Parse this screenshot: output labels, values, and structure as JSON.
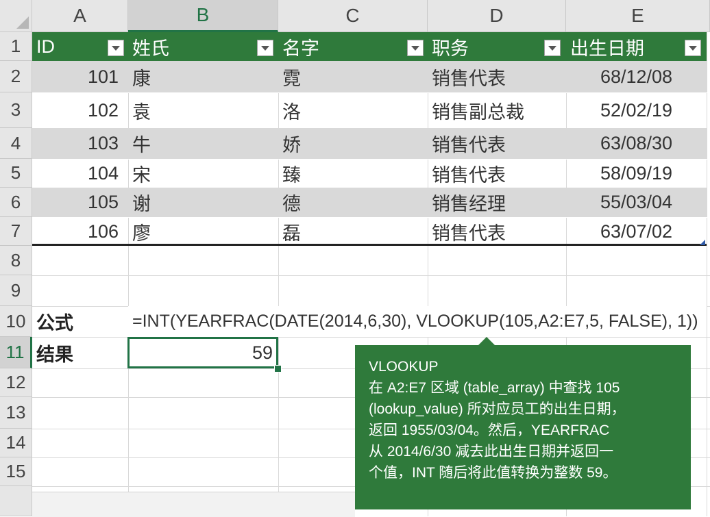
{
  "columns": [
    "A",
    "B",
    "C",
    "D",
    "E"
  ],
  "selected_column": "B",
  "rows": [
    "1",
    "2",
    "3",
    "4",
    "5",
    "6",
    "7",
    "8",
    "9",
    "10",
    "11",
    "12",
    "13",
    "14",
    "15"
  ],
  "selected_row": "11",
  "table": {
    "headers": [
      "ID",
      "姓氏",
      "名字",
      "职务",
      "出生日期"
    ],
    "body": [
      [
        "101",
        "康",
        "霓",
        "销售代表",
        "68/12/08"
      ],
      [
        "102",
        "袁",
        "洛",
        "销售副总裁",
        "52/02/19"
      ],
      [
        "103",
        "牛",
        "娇",
        "销售代表",
        "63/08/30"
      ],
      [
        "104",
        "宋",
        "臻",
        "销售代表",
        "58/09/19"
      ],
      [
        "105",
        "谢",
        "德",
        "销售经理",
        "55/03/04"
      ],
      [
        "106",
        "廖",
        "磊",
        "销售代表",
        "63/07/02"
      ]
    ]
  },
  "formula": {
    "label": "公式",
    "text": "=INT(YEARFRAC(DATE(2014,6,30), VLOOKUP(105,A2:E7,5, FALSE), 1))"
  },
  "result": {
    "label": "结果",
    "value": "59"
  },
  "callout": {
    "title": "VLOOKUP",
    "lines": [
      "在 A2:E7 区域 (table_array) 中查找 105",
      "(lookup_value) 所对应员工的出生日期，",
      "返回 1955/03/04。然后，YEARFRAC",
      "从 2014/6/30 减去此出生日期并返回一",
      "个值，INT 随后将此值转换为整数 59。"
    ]
  },
  "colors": {
    "table_header": "#2f7a3b",
    "band": "#d9d9d9",
    "active_border": "#217346",
    "callout_bg": "#2f7a3b"
  }
}
